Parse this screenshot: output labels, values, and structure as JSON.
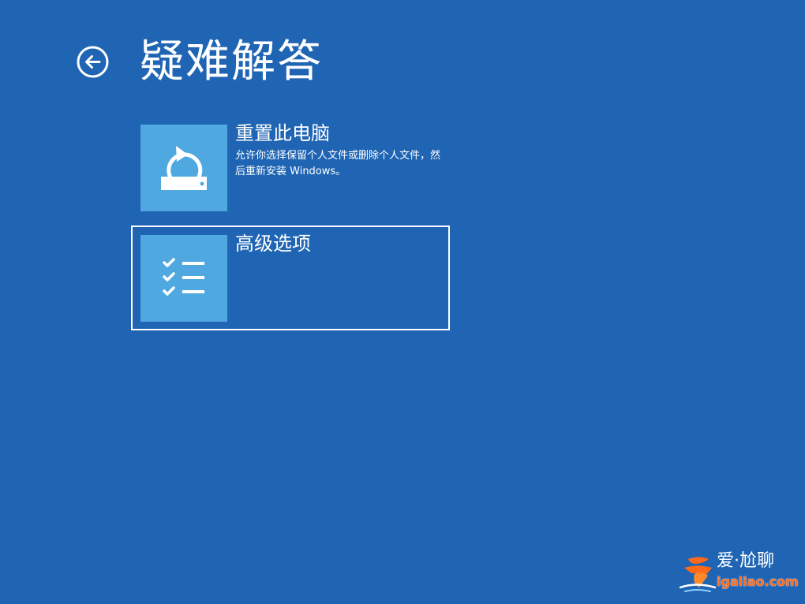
{
  "header": {
    "title": "疑难解答"
  },
  "options": [
    {
      "title": "重置此电脑",
      "description": "允许你选择保留个人文件或删除个人文件，然后重新安装 Windows。"
    },
    {
      "title": "高级选项",
      "description": ""
    }
  ],
  "watermark": {
    "title": "爱·尬聊",
    "url": "igaliao.com"
  },
  "colors": {
    "background": "#1f65b4",
    "tile": "#4fa8e0",
    "selection_border": "#ffffff",
    "watermark_accent": "#ff6a1a"
  },
  "icons": {
    "back": "back-arrow-circle-icon",
    "reset": "reset-pc-icon",
    "advanced": "checklist-icon",
    "watermark": "igaliao-logo-icon"
  }
}
